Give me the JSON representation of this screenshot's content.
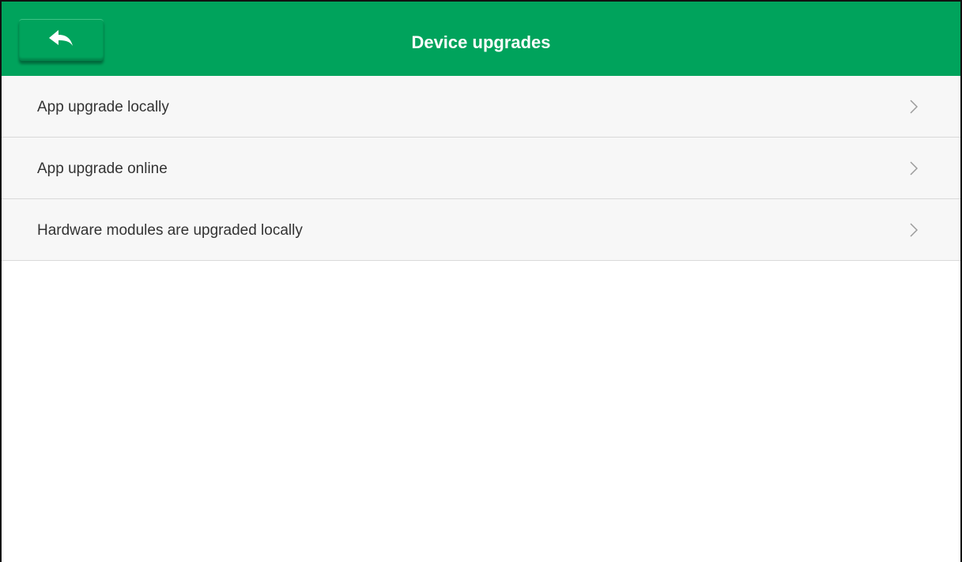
{
  "header": {
    "title": "Device upgrades",
    "back_icon": "back-arrow-icon",
    "background_color": "#00a35c"
  },
  "menu": {
    "items": [
      {
        "label": "App upgrade locally",
        "icon": "chevron-right-icon"
      },
      {
        "label": "App upgrade online",
        "icon": "chevron-right-icon"
      },
      {
        "label": "Hardware modules are upgraded locally",
        "icon": "chevron-right-icon"
      }
    ]
  }
}
